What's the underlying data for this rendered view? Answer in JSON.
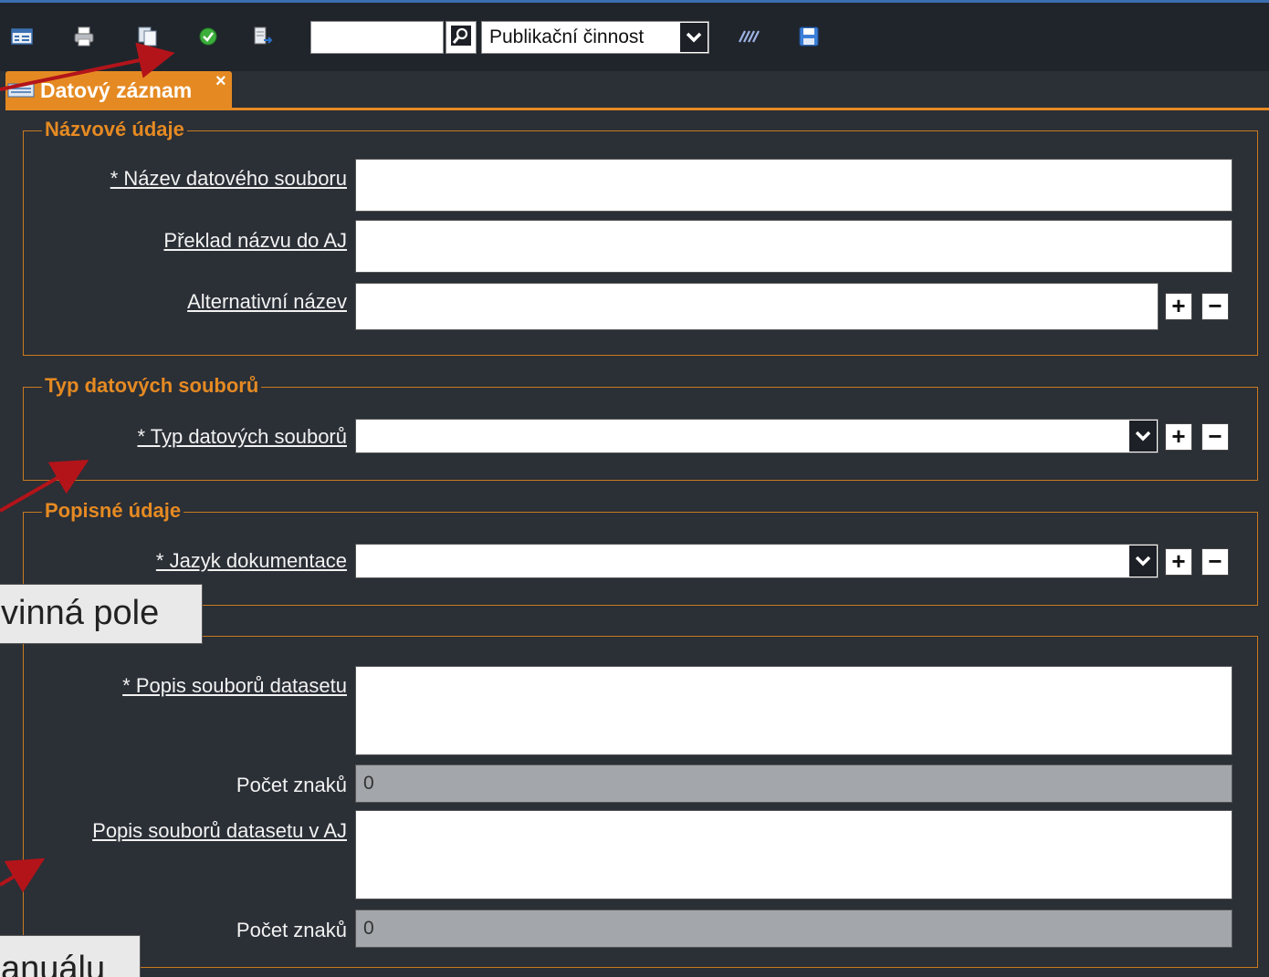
{
  "toolbar": {
    "search_value": "",
    "select_value": "Publikační činnost",
    "icons": [
      "table-icon",
      "print-icon",
      "copy-icon",
      "check-icon",
      "export-icon",
      "search-icon",
      "chevron-down-icon",
      "lines-icon",
      "save-icon"
    ]
  },
  "tab": {
    "label": "Datový záznam",
    "close": "×"
  },
  "sections": {
    "nazvove": {
      "legend": "Názvové údaje",
      "fields": {
        "nazev": {
          "label": "* Název datového souboru",
          "value": ""
        },
        "preklad": {
          "label": "Překlad názvu do AJ",
          "value": ""
        },
        "alternativni": {
          "label": "Alternativní název",
          "value": ""
        }
      }
    },
    "typ": {
      "legend": "Typ datových souborů",
      "fields": {
        "typ": {
          "label": "* Typ datových souborů",
          "value": ""
        }
      }
    },
    "popisne": {
      "legend": "Popisné údaje",
      "fields": {
        "jazyk": {
          "label": "* Jazyk dokumentace",
          "value": ""
        }
      }
    },
    "popis": {
      "fields": {
        "popis": {
          "label": "* Popis souborů datasetu",
          "value": ""
        },
        "pocet1": {
          "label": "Počet znaků",
          "value": "0"
        },
        "popis_aj": {
          "label": "Popis souborů datasetu v AJ",
          "value": ""
        },
        "pocet2": {
          "label": "Počet znaků",
          "value": "0"
        }
      }
    }
  },
  "buttons": {
    "plus": "+",
    "minus": "−"
  },
  "callouts": {
    "first": "vinná pole",
    "second": "anuálu"
  },
  "colors": {
    "accent": "#e58a22",
    "background": "#2b2f36",
    "arrow": "#b3141a"
  }
}
